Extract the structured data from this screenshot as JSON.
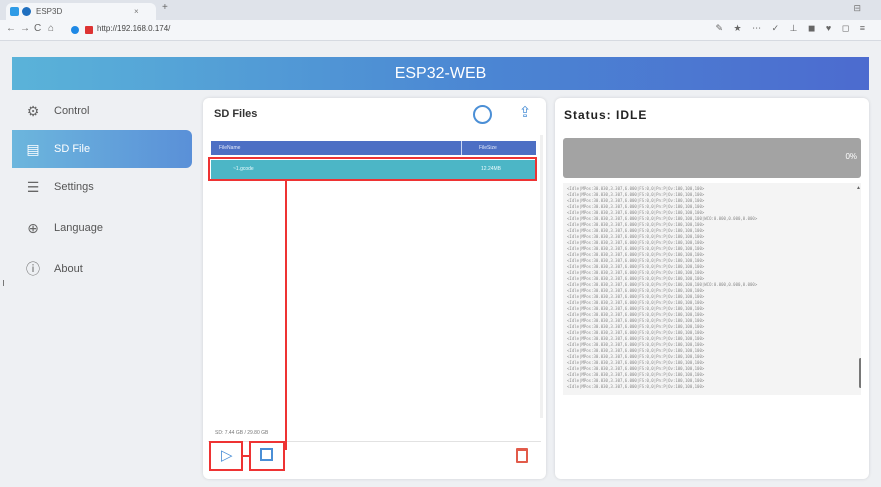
{
  "browser": {
    "tab_title": "ESP3D",
    "tab_close": "×",
    "tab_new": "+",
    "window_controls": "⊟",
    "url": "http://192.168.0.174/",
    "nav": {
      "back": "←",
      "forward": "→",
      "reload": "C",
      "home": "⌂"
    },
    "toolbar_icons": "✎ ★ ⋯ ✓ ⊥ ◼ ♥ ◻ ≡"
  },
  "header": {
    "title": "ESP32-WEB"
  },
  "sidebar": {
    "items": [
      {
        "label": "Control",
        "icon": "control-icon",
        "glyph": "⚙"
      },
      {
        "label": "SD File",
        "icon": "sd-file-icon",
        "glyph": "▤"
      },
      {
        "label": "Settings",
        "icon": "settings-icon",
        "glyph": "☰"
      },
      {
        "label": "Language",
        "icon": "globe-icon",
        "glyph": "⊕"
      },
      {
        "label": "About",
        "icon": "info-icon",
        "glyph": "ⓘ"
      }
    ]
  },
  "sd_panel": {
    "title": "SD Files",
    "table_headers": [
      "FileName",
      "FileSize"
    ],
    "rows": [
      {
        "name": "~1.gcode",
        "size": "12.24MB"
      }
    ],
    "usage": "SD: 7.44 GB / 29.80 GB"
  },
  "status_panel": {
    "title": "Status: IDLE",
    "progress": 0,
    "progress_text": "0%",
    "log_lines": [
      "<Idle|MPos:30.030,3.307,6.000|FS:0,0|Pn:P|Ov:100,100,100>",
      "<Idle|MPos:30.030,3.307,6.000|FS:0,0|Pn:P|Ov:100,100,100>",
      "<Idle|MPos:30.030,3.307,6.000|FS:0,0|Pn:P|Ov:100,100,100>",
      "<Idle|MPos:30.030,3.307,6.000|FS:0,0|Pn:P|Ov:100,100,100>",
      "<Idle|MPos:30.030,3.307,6.000|FS:0,0|Pn:P|Ov:100,100,100>",
      "<Idle|MPos:30.030,3.307,6.000|FS:0,0|Pn:P|Ov:100,100,100|WCO:0.000,0.000,0.000>",
      "<Idle|MPos:30.030,3.307,6.000|FS:0,0|Pn:P|Ov:100,100,100>",
      "<Idle|MPos:30.030,3.307,6.000|FS:0,0|Pn:P|Ov:100,100,100>",
      "<Idle|MPos:30.030,3.307,6.000|FS:0,0|Pn:P|Ov:100,100,100>",
      "<Idle|MPos:30.030,3.307,6.000|FS:0,0|Pn:P|Ov:100,100,100>",
      "<Idle|MPos:30.030,3.307,6.000|FS:0,0|Pn:P|Ov:100,100,100>",
      "<Idle|MPos:30.030,3.307,6.000|FS:0,0|Pn:P|Ov:100,100,100>",
      "<Idle|MPos:30.030,3.307,6.000|FS:0,0|Pn:P|Ov:100,100,100>",
      "<Idle|MPos:30.030,3.307,6.000|FS:0,0|Pn:P|Ov:100,100,100>",
      "<Idle|MPos:30.030,3.307,6.000|FS:0,0|Pn:P|Ov:100,100,100>",
      "<Idle|MPos:30.030,3.307,6.000|FS:0,0|Pn:P|Ov:100,100,100>",
      "<Idle|MPos:30.030,3.307,6.000|FS:0,0|Pn:P|Ov:100,100,100|WCO:0.000,0.000,0.000>",
      "<Idle|MPos:30.030,3.307,6.000|FS:0,0|Pn:P|Ov:100,100,100>",
      "<Idle|MPos:30.030,3.307,6.000|FS:0,0|Pn:P|Ov:100,100,100>",
      "<Idle|MPos:30.030,3.307,6.000|FS:0,0|Pn:P|Ov:100,100,100>",
      "<Idle|MPos:30.030,3.307,6.000|FS:0,0|Pn:P|Ov:100,100,100>",
      "<Idle|MPos:30.030,3.307,6.000|FS:0,0|Pn:P|Ov:100,100,100>",
      "<Idle|MPos:30.030,3.307,6.000|FS:0,0|Pn:P|Ov:100,100,100>",
      "<Idle|MPos:30.030,3.307,6.000|FS:0,0|Pn:P|Ov:100,100,100>",
      "<Idle|MPos:30.030,3.307,6.000|FS:0,0|Pn:P|Ov:100,100,100>",
      "<Idle|MPos:30.030,3.307,6.000|FS:0,0|Pn:P|Ov:100,100,100>",
      "<Idle|MPos:30.030,3.307,6.000|FS:0,0|Pn:P|Ov:100,100,100>",
      "<Idle|MPos:30.030,3.307,6.000|FS:0,0|Pn:P|Ov:100,100,100>",
      "<Idle|MPos:30.030,3.307,6.000|FS:0,0|Pn:P|Ov:100,100,100>",
      "<Idle|MPos:30.030,3.307,6.000|FS:0,0|Pn:P|Ov:100,100,100>",
      "<Idle|MPos:30.030,3.307,6.000|FS:0,0|Pn:P|Ov:100,100,100>",
      "<Idle|MPos:30.030,3.307,6.000|FS:0,0|Pn:P|Ov:100,100,100>",
      "<Idle|MPos:30.030,3.307,6.000|FS:0,0|Pn:P|Ov:100,100,100>",
      "<Idle|MPos:30.030,3.307,6.000|FS:0,0|Pn:P|Ov:100,100,100>"
    ]
  },
  "colors": {
    "accent": "#4b8fd6",
    "header_gradient": [
      "#5ab3d9",
      "#4c6bcf"
    ],
    "highlight_row": "#4cb6c6",
    "annotation": "#ee3333"
  }
}
